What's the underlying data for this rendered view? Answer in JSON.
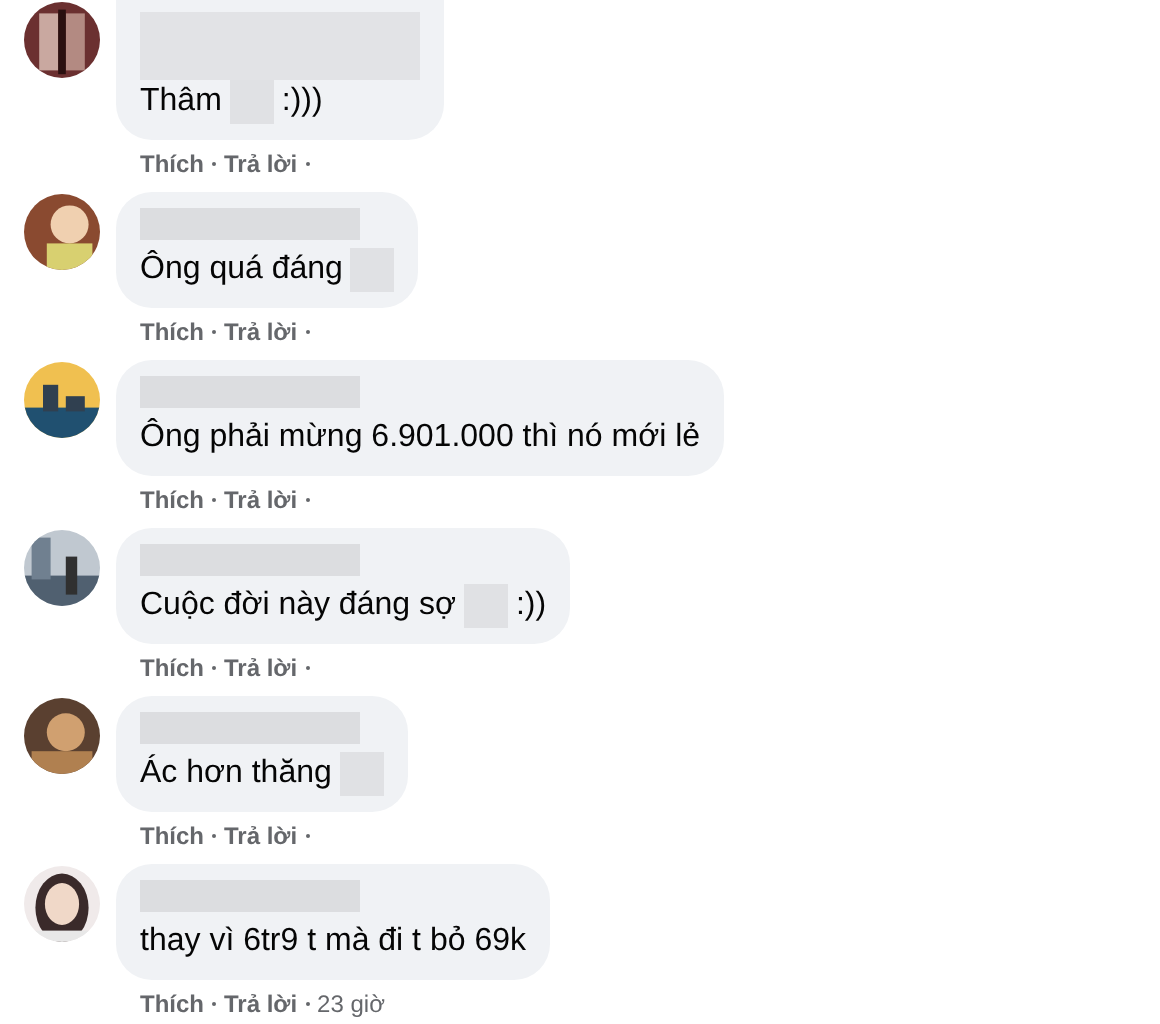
{
  "comments": [
    {
      "segments": [
        {
          "kind": "text",
          "text": "Thâm"
        },
        {
          "kind": "redaction"
        },
        {
          "kind": "text",
          "text": ":)))"
        }
      ],
      "actions": [
        "Thích",
        "Trả lời"
      ],
      "cut_top": true
    },
    {
      "segments": [
        {
          "kind": "text",
          "text": "Ông quá đáng"
        },
        {
          "kind": "redaction"
        }
      ],
      "actions": [
        "Thích",
        "Trả lời"
      ]
    },
    {
      "segments": [
        {
          "kind": "text",
          "text": "Ông phải mừng 6.901.000 thì nó mới lẻ"
        }
      ],
      "actions": [
        "Thích",
        "Trả lời"
      ]
    },
    {
      "segments": [
        {
          "kind": "text",
          "text": "Cuộc đời này đáng sợ"
        },
        {
          "kind": "redaction"
        },
        {
          "kind": "text",
          "text": ":))"
        }
      ],
      "actions": [
        "Thích",
        "Trả lời"
      ]
    },
    {
      "segments": [
        {
          "kind": "text",
          "text": "Ác hơn thăng"
        },
        {
          "kind": "redaction"
        }
      ],
      "actions": [
        "Thích",
        "Trả lời"
      ]
    },
    {
      "segments": [
        {
          "kind": "text",
          "text": "thay vì 6tr9 t mà đi t bỏ 69k"
        }
      ],
      "actions": [
        "Thích",
        "Trả lời"
      ],
      "time": "23 giờ"
    }
  ]
}
